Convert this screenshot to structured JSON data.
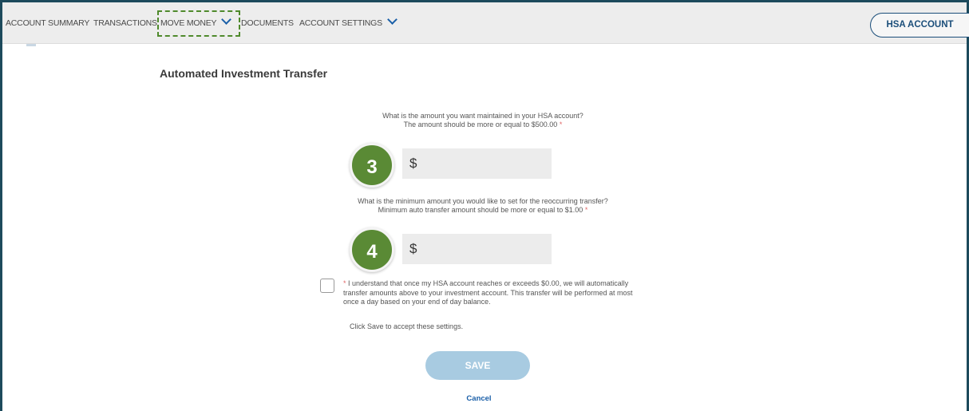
{
  "nav": {
    "items": [
      {
        "label": "ACCOUNT SUMMARY",
        "has_dropdown": false
      },
      {
        "label": "TRANSACTIONS",
        "has_dropdown": false
      },
      {
        "label": "MOVE MONEY",
        "has_dropdown": true,
        "highlighted": true
      },
      {
        "label": "DOCUMENTS",
        "has_dropdown": false
      },
      {
        "label": "ACCOUNT SETTINGS",
        "has_dropdown": true
      }
    ],
    "account_button": "HSA ACCOUNT"
  },
  "page": {
    "title": "Automated Investment Transfer"
  },
  "maintain": {
    "question_line1": "What is the amount you want maintained in your HSA account?",
    "question_line2": "The amount should be more or equal to $500.00",
    "required_mark": "*",
    "currency_symbol": "$",
    "step_badge": "3"
  },
  "minimum": {
    "question_line1": "What is the minimum amount you would like to set for the reoccurring transfer?",
    "question_line2": "Minimum auto transfer amount should be more or equal to $1.00",
    "required_mark": "*",
    "currency_symbol": "$",
    "step_badge": "4"
  },
  "agreement": {
    "required_mark": "*",
    "text": "I understand that once my HSA account reaches or exceeds $0.00, we will automatically transfer amounts above to your investment account. This transfer will be performed at most once a day based on your end of day balance.",
    "checked": false,
    "click_save_text": "Click Save to accept these settings."
  },
  "actions": {
    "save_label": "SAVE",
    "cancel_label": "Cancel"
  },
  "colors": {
    "nav_chevron": "#1a5fa8",
    "badge_green": "#5a8a35",
    "save_disabled": "#a8cbe1",
    "link_blue": "#1a5fa8",
    "frame": "#1d4a5c"
  }
}
